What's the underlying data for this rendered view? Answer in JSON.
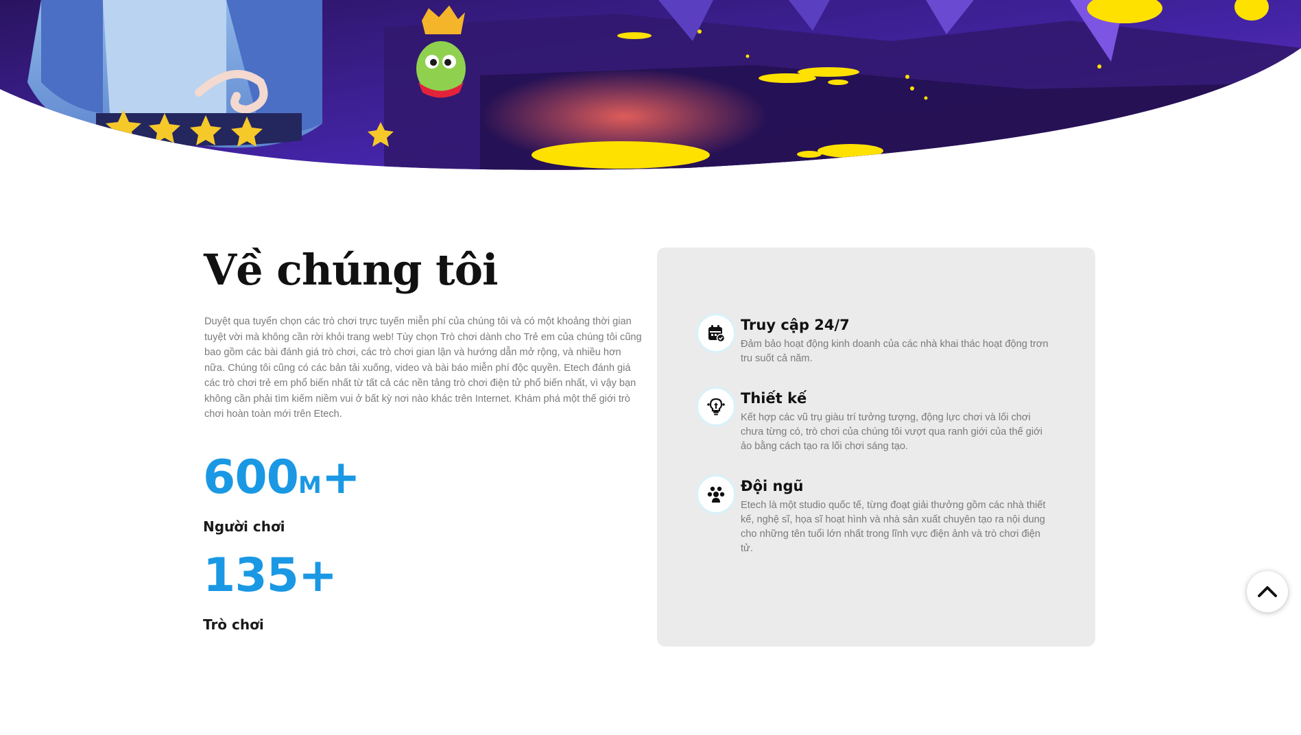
{
  "about": {
    "title": "Về chúng tôi",
    "description": "Duyệt qua tuyển chọn các trò chơi trực tuyến miễn phí của chúng tôi và có một khoảng thời gian tuyệt vời mà không cần rời khỏi trang web! Tùy chọn Trò chơi dành cho Trẻ em của chúng tôi cũng bao gồm các bài đánh giá trò chơi, các trò chơi gian lận và hướng dẫn mở rộng, và nhiều hơn nữa. Chúng tôi cũng có các bản tải xuống, video và bài báo miễn phí độc quyền. Etech đánh giá các trò chơi trẻ em phổ biến nhất từ tất cả các nền tảng trò chơi điện tử phổ biến nhất, vì vậy bạn không cần phải tìm kiếm niềm vui ở bất kỳ nơi nào khác trên Internet. Khám phá một thế giới trò chơi hoàn toàn mới trên Etech."
  },
  "stats": [
    {
      "number": "600",
      "unit": "M",
      "suffix": "+",
      "label": "Người chơi"
    },
    {
      "number": "135",
      "unit": "",
      "suffix": "+",
      "label": "Trò chơi"
    }
  ],
  "features": [
    {
      "icon": "calendar-check-icon",
      "title": "Truy cập 24/7",
      "body": "Đảm bảo hoạt động kinh doanh của các nhà khai thác hoạt động trơn tru suốt cả năm."
    },
    {
      "icon": "design-bulb-icon",
      "title": "Thiết kế",
      "body": "Kết hợp các vũ trụ giàu trí tưởng tượng, động lực chơi và lối chơi chưa từng có, trò chơi của chúng tôi vượt qua ranh giới của thế giới ảo bằng cách tạo ra lối chơi sáng tạo."
    },
    {
      "icon": "team-icon",
      "title": "Đội ngũ",
      "body": "Etech là một studio quốc tế, từng đoạt giải thưởng gồm các nhà thiết kế, nghệ sĩ, họa sĩ hoạt hình và nhà sản xuất chuyên tạo ra nội dung cho những tên tuổi lớn nhất trong lĩnh vực điện ảnh và trò chơi điện tử."
    }
  ],
  "scroll_top": {
    "icon": "chevron-up-icon"
  },
  "colors": {
    "accent": "#1a98e4",
    "card_background": "#ebebeb",
    "icon_ring": "#d8f1f9",
    "hero_purple": "#3d1e8c"
  }
}
